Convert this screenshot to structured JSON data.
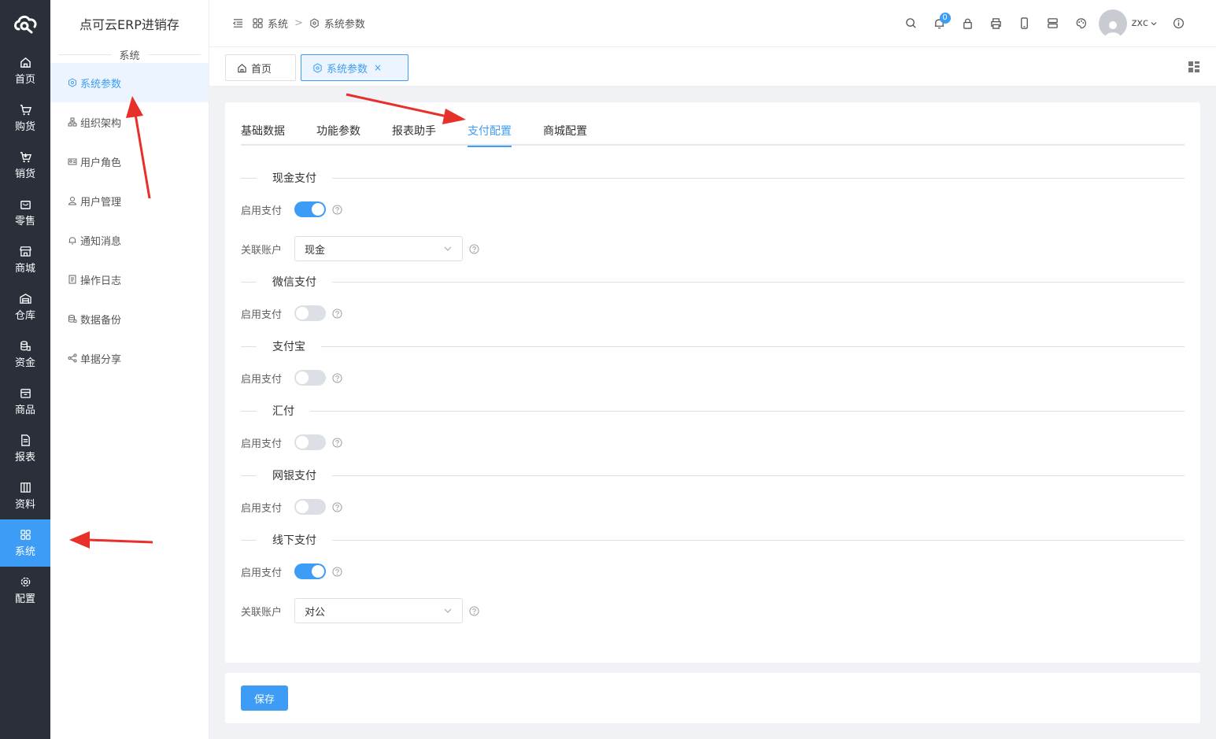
{
  "app": {
    "title": "点可云ERP进销存"
  },
  "rail": {
    "items": [
      {
        "label": "首页",
        "icon": "home-icon"
      },
      {
        "label": "购货",
        "icon": "cart-icon"
      },
      {
        "label": "销货",
        "icon": "cart-out-icon"
      },
      {
        "label": "零售",
        "icon": "bag-icon"
      },
      {
        "label": "商城",
        "icon": "store-icon"
      },
      {
        "label": "仓库",
        "icon": "warehouse-icon"
      },
      {
        "label": "资金",
        "icon": "coins-icon"
      },
      {
        "label": "商品",
        "icon": "box-icon"
      },
      {
        "label": "报表",
        "icon": "report-icon"
      },
      {
        "label": "资料",
        "icon": "library-icon"
      },
      {
        "label": "系统",
        "icon": "grid-icon"
      },
      {
        "label": "配置",
        "icon": "gear-icon"
      }
    ],
    "active": "系统"
  },
  "subnav": {
    "group": "系统",
    "items": [
      {
        "label": "系统参数",
        "icon": "settings-icon"
      },
      {
        "label": "组织架构",
        "icon": "org-icon"
      },
      {
        "label": "用户角色",
        "icon": "role-icon"
      },
      {
        "label": "用户管理",
        "icon": "user-icon"
      },
      {
        "label": "通知消息",
        "icon": "bell-icon"
      },
      {
        "label": "操作日志",
        "icon": "log-icon"
      },
      {
        "label": "数据备份",
        "icon": "backup-icon"
      },
      {
        "label": "单据分享",
        "icon": "share-icon"
      }
    ]
  },
  "header": {
    "breadcrumb": [
      "系统",
      "系统参数"
    ],
    "notifications": "0",
    "username": "zxc"
  },
  "tabs": [
    {
      "label": "首页"
    },
    {
      "label": "系统参数",
      "close": "×"
    }
  ],
  "page": {
    "tabs": [
      "基础数据",
      "功能参数",
      "报表助手",
      "支付配置",
      "商城配置"
    ],
    "active_tab": "支付配置",
    "sections": [
      {
        "title": "现金支付",
        "enable_label": "启用支付",
        "enabled": true,
        "account_label": "关联账户",
        "account": "现金"
      },
      {
        "title": "微信支付",
        "enable_label": "启用支付",
        "enabled": false
      },
      {
        "title": "支付宝",
        "enable_label": "启用支付",
        "enabled": false
      },
      {
        "title": "汇付",
        "enable_label": "启用支付",
        "enabled": false
      },
      {
        "title": "网银支付",
        "enable_label": "启用支付",
        "enabled": false
      },
      {
        "title": "线下支付",
        "enable_label": "启用支付",
        "enabled": true,
        "account_label": "关联账户",
        "account": "对公"
      }
    ],
    "save_label": "保存"
  },
  "colors": {
    "accent": "#3d9cf5",
    "rail_bg": "#2b2f3a",
    "annotation": "#e8302a"
  }
}
